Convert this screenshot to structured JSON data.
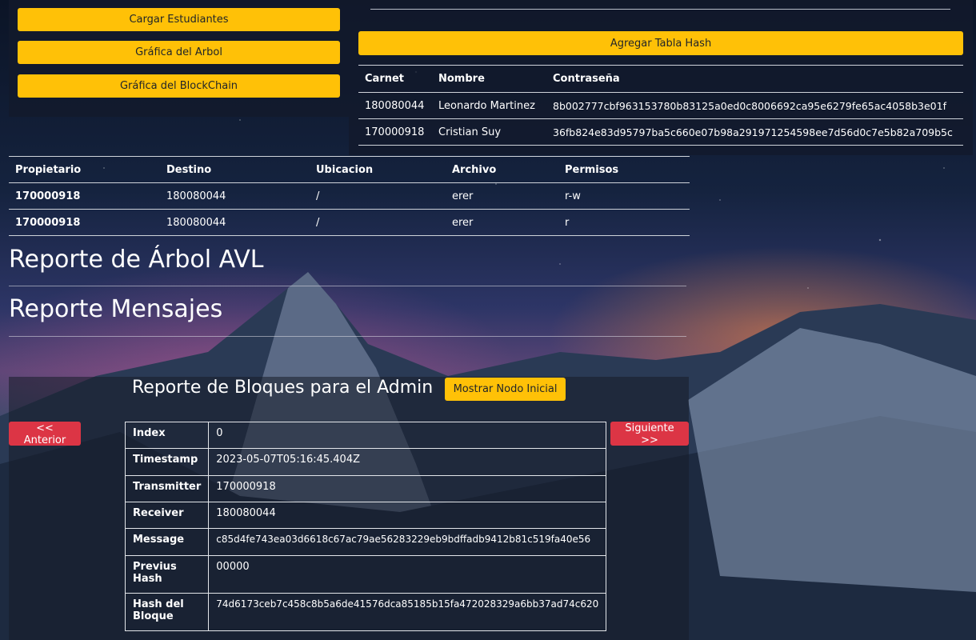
{
  "left_buttons": [
    "Cargar Estudiantes",
    "Gráfica del Arbol",
    "Gráfica del BlockChain"
  ],
  "hash": {
    "button_label": "Agregar Tabla Hash",
    "headers": [
      "Carnet",
      "Nombre",
      "Contraseña"
    ],
    "rows": [
      [
        "180080044",
        "Leonardo Martinez",
        "8b002777cbf963153780b83125a0ed0c8006692ca95e6279fe65ac4058b3e01f"
      ],
      [
        "170000918",
        "Cristian Suy",
        "36fb824e83d95797ba5c660e07b98a291971254598ee7d56d0c7e5b82a709b5c"
      ]
    ]
  },
  "permisos": {
    "headers": [
      "Propietario",
      "Destino",
      "Ubicacion",
      "Archivo",
      "Permisos"
    ],
    "rows": [
      [
        "170000918",
        "180080044",
        "/",
        "erer",
        "r-w"
      ],
      [
        "170000918",
        "180080044",
        "/",
        "erer",
        "r"
      ]
    ]
  },
  "headings": {
    "avl": "Reporte de Árbol AVL",
    "mensajes": "Reporte Mensajes"
  },
  "bloques": {
    "title": "Reporte de Bloques para el Admin",
    "show_initial_label": "Mostrar Nodo Inicial",
    "prev_label": "<< Anterior",
    "next_label": "Siguiente >>",
    "rows": [
      [
        "Index",
        "0"
      ],
      [
        "Timestamp",
        "2023-05-07T05:16:45.404Z"
      ],
      [
        "Transmitter",
        "170000918"
      ],
      [
        "Receiver",
        "180080044"
      ],
      [
        "Message",
        "c85d4fe743ea03d6618c67ac79ae56283229eb9bdffadb9412b81c519fa40e56"
      ],
      [
        "Previus Hash",
        "00000"
      ],
      [
        "Hash del Bloque",
        "74d6173ceb7c458c8b5a6de41576dca85185b15fa472028329a6bb37ad74c620"
      ]
    ]
  },
  "colors": {
    "primary_button": "#ffc107",
    "danger_button": "#dc3545"
  }
}
